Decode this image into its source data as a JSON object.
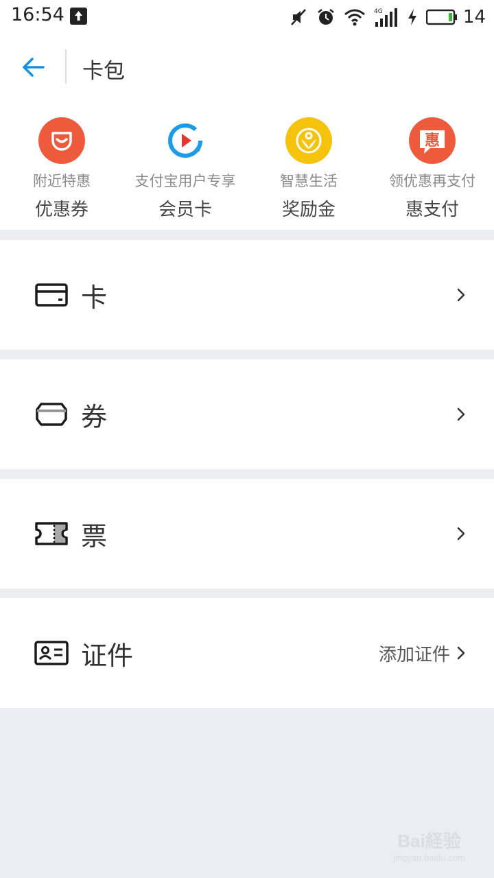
{
  "status_bar": {
    "time": "16:54",
    "battery_level": "14",
    "network": "4G",
    "icons": [
      "upload-notification-icon",
      "mute-icon",
      "alarm-icon",
      "wifi-icon",
      "signal-icon",
      "charging-icon",
      "battery-icon"
    ]
  },
  "header": {
    "title": "卡包",
    "back_icon": "arrow-left-icon"
  },
  "quick_entries": [
    {
      "sub": "附近特惠",
      "main": "优惠券",
      "icon": "coupon-smile-icon",
      "color": "#ee5a3c"
    },
    {
      "sub": "支付宝用户专享",
      "main": "会员卡",
      "icon": "play-ring-icon",
      "color": "#1e9be6"
    },
    {
      "sub": "智慧生活",
      "main": "奖励金",
      "icon": "sprout-coin-icon",
      "color": "#f5c20c"
    },
    {
      "sub": "领优惠再支付",
      "main": "惠支付",
      "icon": "hui-badge-icon",
      "color": "#ee5a3c",
      "glyph": "惠"
    }
  ],
  "rows": [
    {
      "label": "卡",
      "icon": "card-icon",
      "extra": ""
    },
    {
      "label": "券",
      "icon": "coupon-icon",
      "extra": ""
    },
    {
      "label": "票",
      "icon": "ticket-icon",
      "extra": ""
    },
    {
      "label": "证件",
      "icon": "id-card-icon",
      "extra": "添加证件"
    }
  ],
  "watermark": {
    "logo": "Bai経验",
    "url": "jingyan.baidu.com"
  }
}
